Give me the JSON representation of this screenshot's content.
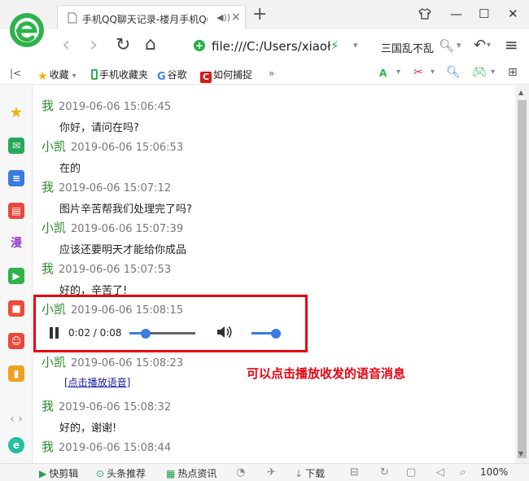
{
  "tab": {
    "title": "手机QQ聊天记录-楼月手机QQ",
    "close": "×",
    "speaker": "◀))"
  },
  "window": {
    "newtab": "+",
    "shirt": "👕",
    "min": "—",
    "max": "☐",
    "close": "✕"
  },
  "nav": {
    "back": "‹",
    "forward": "›",
    "refresh": "↻",
    "home": "⌂",
    "url": "file:///C:/Users/xiaoł",
    "search_text": "三国乱不乱",
    "undo": "↶",
    "menu": "≡"
  },
  "bookmarks": {
    "collapse": "ＩＣ",
    "items": [
      {
        "label": "收藏",
        "icon": "star-icon"
      },
      {
        "label": "手机收藏夹",
        "icon": "phone-icon"
      },
      {
        "label": "谷歌",
        "icon": "google-icon"
      },
      {
        "label": "如何捕捉",
        "icon": "c-icon"
      }
    ],
    "more": "»"
  },
  "sidebar": {
    "manga_label": "漫"
  },
  "messages": [
    {
      "sender": "我",
      "time": "2019-06-06 15:06:45",
      "text": "你好，请问在吗?"
    },
    {
      "sender": "小凯",
      "time": "2019-06-06 15:06:53",
      "text": "在的"
    },
    {
      "sender": "我",
      "time": "2019-06-06 15:07:12",
      "text": "图片辛苦帮我们处理完了吗?"
    },
    {
      "sender": "小凯",
      "time": "2019-06-06 15:07:39",
      "text": "应该还要明天才能给你成品"
    },
    {
      "sender": "我",
      "time": "2019-06-06 15:07:53",
      "text": "好的，辛苦了!"
    },
    {
      "sender": "小凯",
      "time": "2019-06-06 15:08:15",
      "text": ""
    },
    {
      "sender": "小凯",
      "time": "2019-06-06 15:08:23",
      "link": "[点击播放语音]"
    },
    {
      "sender": "我",
      "time": "2019-06-06 15:08:32",
      "text": "好的，谢谢!"
    },
    {
      "sender": "我",
      "time": "2019-06-06 15:08:44",
      "text": ""
    }
  ],
  "player": {
    "time": "0:02 / 0:08",
    "progress": 0.25,
    "volume": 1.0
  },
  "annotation": "可以点击播放收发的语音消息",
  "status": {
    "items": [
      "快剪辑",
      "头条推荐",
      "热点资讯"
    ],
    "download": "下载",
    "zoom": "100%"
  },
  "colors": {
    "sender": "#2a8c2a",
    "accent": "#3a7be0",
    "highlight": "#e8000e"
  }
}
